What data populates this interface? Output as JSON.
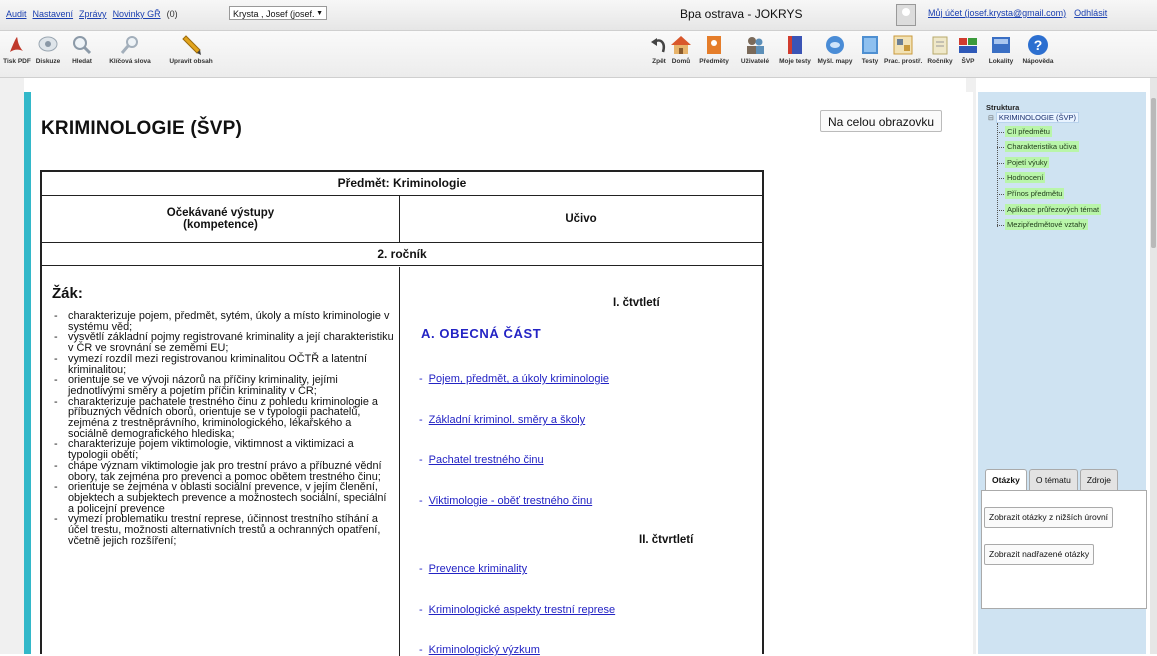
{
  "topbar": {
    "links": [
      "Audit",
      "Nastavení",
      "Zprávy",
      "Novinky GŘ"
    ],
    "news_count": "(0)",
    "user_select": "Krysta , Josef (josef.",
    "app_title": "Bpa ostrava - JOKRYS",
    "account_link": "Můj účet (josef.krysta@gmail.com)",
    "logout_link": "Odhlásit"
  },
  "toolbar": {
    "left": [
      {
        "label": "Tisk PDF",
        "icon": "pdf-icon",
        "color": "#c0392b"
      },
      {
        "label": "Diskuze",
        "icon": "chat-icon",
        "color": "#cfd8e0"
      },
      {
        "label": "Hledat",
        "icon": "search-icon",
        "color": "#b9c6d2"
      },
      {
        "label": "Klíčová slova",
        "icon": "key-search-icon",
        "color": "#c3cdd6"
      },
      {
        "label": "Upravit obsah",
        "icon": "pencil-icon",
        "color": "#e3a51d"
      }
    ],
    "right": [
      {
        "label": "Zpět",
        "icon": "back-icon",
        "color": "#555555"
      },
      {
        "label": "Domů",
        "icon": "home-icon",
        "color": "#d9572b"
      },
      {
        "label": "Předměty",
        "icon": "subjects-icon",
        "color": "#e57d2a"
      },
      {
        "label": "Uživatelé",
        "icon": "users-icon",
        "color": "#7a6a5a"
      },
      {
        "label": "Moje testy",
        "icon": "my-tests-icon",
        "color": "#3b54b5"
      },
      {
        "label": "Myšl. mapy",
        "icon": "mind-map-icon",
        "color": "#4a8cd6"
      },
      {
        "label": "Testy",
        "icon": "tests-icon",
        "color": "#4e8fd1"
      },
      {
        "label": "Prac. prostř.",
        "icon": "workspace-icon",
        "color": "#c99a3c"
      },
      {
        "label": "Ročníky",
        "icon": "grades-icon",
        "color": "#d8d0a8"
      },
      {
        "label": "ŠVP",
        "icon": "svp-icon",
        "color": "#d13c2f"
      },
      {
        "label": "Lokality",
        "icon": "locations-icon",
        "color": "#3a6fc4"
      },
      {
        "label": "Nápověda",
        "icon": "help-icon",
        "color": "#2c6fd0"
      }
    ]
  },
  "page": {
    "title": "KRIMINOLOGIE (ŠVP)",
    "fullscreen_button": "Na celou obrazovku"
  },
  "table": {
    "subject": "Předmět: Kriminologie",
    "col1_header_line1": "Očekávané výstupy",
    "col1_header_line2": "(kompetence)",
    "col2_header": "Učivo",
    "grade": "2. ročník",
    "student_label": "Žák:",
    "outcomes": [
      "charakterizuje pojem, předmět, sytém, úkoly a místo kriminologie v systému věd;",
      "vysvětlí základní pojmy registrované kriminality a její charakteristiku v ČR ve srovnání se zeměmi EU;",
      "vymezí rozdíl mezi registrovanou kriminalitou OČTŘ a latentní kriminalitou;",
      "orientuje se ve  vývoji názorů na příčiny kriminality, jejími jednotlivými směry a pojetím příčin kriminality v ČR;",
      "charakterizuje pachatele trestného činu z pohledu kriminologie a příbuzných vědních oborů, orientuje se v typologii pachatelů, zejména z trestněprávního, kriminologického, lékařského a sociálně demografického hlediska;",
      "charakterizuje pojem viktimologie, viktimnost a viktimizaci a typologii obětí;",
      "chápe význam viktimologie jak pro trestní právo a příbuzné vědní obory, tak zejména pro prevenci a pomoc obětem trestného činu;",
      "orientuje se zejména v oblasti sociální prevence, v jejím členění, objektech a subjektech prevence a možnostech sociální, speciální a policejní prevence",
      "vymezí problematiku trestní represe, účinnost trestního stíhání a účel trestu, možnosti alternativních trestů a ochranných opatření, včetně jejich rozšíření;"
    ],
    "quarter1": "I. čtvtletí",
    "section_a": "A. OBECNÁ ČÁST",
    "topics_q1": [
      "Pojem, předmět, a úkoly kriminologie",
      "Základní kriminol. směry a školy",
      "Pachatel trestného činu",
      "Viktimologie - oběť trestného činu"
    ],
    "quarter2": "II. čtvrtletí",
    "topics_q2": [
      "Prevence kriminality",
      "Kriminologické aspekty trestní represe",
      "Kriminologický výzkum"
    ]
  },
  "structure": {
    "title": "Struktura",
    "root": "KRIMINOLOGIE (ŠVP)",
    "items": [
      "Cíl předmětu",
      "Charakteristika učiva",
      "Pojetí výuky",
      "Hodnocení",
      "Přínos předmětu",
      "Aplikace průřezových témat",
      "Mezipředmětové vztahy"
    ]
  },
  "side_tabs": {
    "tabs": [
      "Otázky",
      "O tématu",
      "Zdroje"
    ],
    "active": "Otázky",
    "button1": "Zobrazit otázky z nižších úrovní",
    "button2": "Zobrazit nadřazené otázky"
  }
}
